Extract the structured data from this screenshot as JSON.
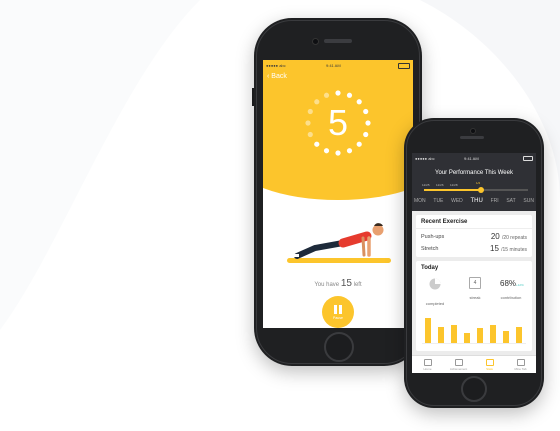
{
  "workout_screen": {
    "status_carrier": "●●●●● abc",
    "status_time": "9:41 AM",
    "back_label": "Back",
    "countdown": "5",
    "remaining_prefix": "You have",
    "remaining_count": "15",
    "remaining_suffix": "left",
    "pause_label": "Pause"
  },
  "performance_screen": {
    "status_carrier": "●●●●● abc",
    "status_time": "9:41 AM",
    "title": "Your Performance This Week",
    "timeline_dates": [
      "12/25",
      "12/26",
      "12/28",
      "1/2"
    ],
    "days": [
      "MON",
      "TUE",
      "WED",
      "THU",
      "FRI",
      "SAT",
      "SUN"
    ],
    "active_day": "THU",
    "recent": {
      "title": "Recent Exercise",
      "items": [
        {
          "name": "Push-ups",
          "value": "20",
          "target": "/20 repeats"
        },
        {
          "name": "Stretch",
          "value": "15",
          "target": "/15 minutes"
        }
      ]
    },
    "today": {
      "title": "Today",
      "completed_label": "completed",
      "streak_value": "4",
      "streak_label": "streak",
      "contribution_value": "68%",
      "contribution_change": "+12%",
      "contribution_label": "contribution",
      "bar_values": [
        0.85,
        0.55,
        0.6,
        0.35,
        0.5,
        0.6,
        0.4,
        0.55
      ]
    },
    "tabs": [
      {
        "label": "Home",
        "active": false
      },
      {
        "label": "Achievement",
        "active": false
      },
      {
        "label": "Stats",
        "active": true
      },
      {
        "label": "Mine Tab",
        "active": false
      }
    ]
  },
  "colors": {
    "accent": "#fcc52c",
    "dark": "#2f3035",
    "teal": "#49c9c0"
  }
}
